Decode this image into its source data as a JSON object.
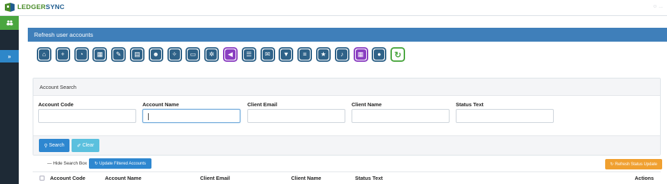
{
  "app": {
    "logo_part1": "LEDGER",
    "logo_part2": "SYNC",
    "top_right": "☺ ..."
  },
  "sidebar": {
    "expand_glyph": "»"
  },
  "panel": {
    "title": "Refresh user accounts"
  },
  "toolbar": {
    "icons": [
      {
        "name": "home-icon",
        "glyph": "⌂",
        "color": "#2f6288"
      },
      {
        "name": "plus-icon",
        "glyph": "+",
        "color": "#2f6288"
      },
      {
        "name": "pie-chart-icon",
        "glyph": "◔",
        "color": "#2f6288"
      },
      {
        "name": "calculator-icon",
        "glyph": "▦",
        "color": "#2f6288"
      },
      {
        "name": "edit-icon",
        "glyph": "✎",
        "color": "#2f6288"
      },
      {
        "name": "book-icon",
        "glyph": "▤",
        "color": "#2f6288"
      },
      {
        "name": "users-icon",
        "glyph": "☻",
        "color": "#2f6288"
      },
      {
        "name": "wrench-icon",
        "glyph": "✧",
        "color": "#2f6288"
      },
      {
        "name": "credit-card-icon",
        "glyph": "▭",
        "color": "#2f6288"
      },
      {
        "name": "gear-icon",
        "glyph": "✲",
        "color": "#2f6288"
      },
      {
        "name": "megaphone-icon",
        "glyph": "◀",
        "color": "#8a3fc1"
      },
      {
        "name": "database-icon",
        "glyph": "☰",
        "color": "#2f6288"
      },
      {
        "name": "envelope-icon",
        "glyph": "✉",
        "color": "#2f6288"
      },
      {
        "name": "filter-icon",
        "glyph": "▼",
        "color": "#2f6288"
      },
      {
        "name": "list-icon",
        "glyph": "≡",
        "color": "#2f6288"
      },
      {
        "name": "star-icon",
        "glyph": "★",
        "color": "#2f6288"
      },
      {
        "name": "bell-icon",
        "glyph": "♪",
        "color": "#2f6288"
      },
      {
        "name": "calendar-icon",
        "glyph": "▦",
        "color": "#8a3fc1"
      },
      {
        "name": "user-icon",
        "glyph": "●",
        "color": "#2f6288"
      },
      {
        "name": "refresh-icon",
        "glyph": "↻",
        "color": "#4aa63f"
      }
    ]
  },
  "search": {
    "title": "Account Search",
    "fields": [
      {
        "label": "Account Code",
        "value": ""
      },
      {
        "label": "Account Name",
        "value": ""
      },
      {
        "label": "Client Email",
        "value": ""
      },
      {
        "label": "Client Name",
        "value": ""
      },
      {
        "label": "Status Text",
        "value": ""
      }
    ],
    "search_label": "Search",
    "clear_label": "Clear",
    "search_glyph": "⚲",
    "clear_glyph": "✐"
  },
  "actions": {
    "hide_label": "Hide Search Box",
    "update_label": "Update Filtered Accounts",
    "refresh_label": "Refresh Status Update"
  },
  "table": {
    "headers": [
      "Account Code",
      "Account Name",
      "Client Email",
      "Client Name",
      "Status Text",
      "Actions"
    ]
  }
}
